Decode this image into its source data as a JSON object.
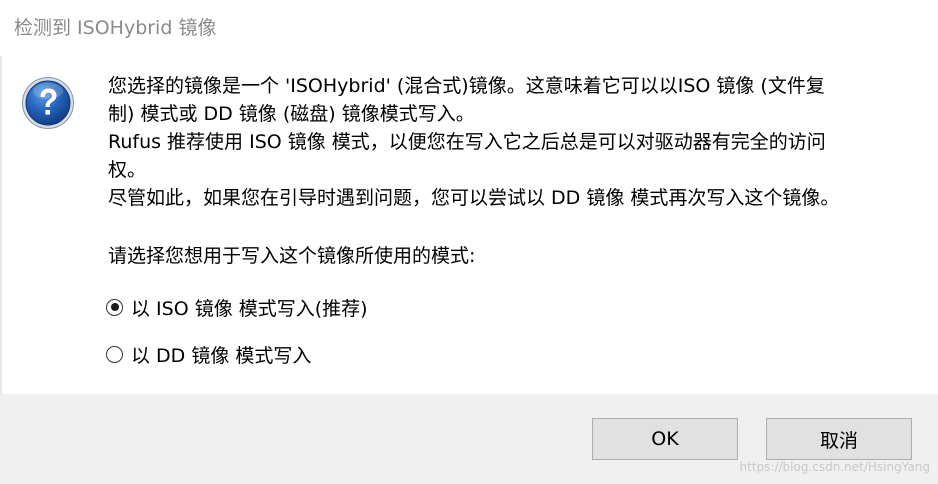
{
  "dialog": {
    "title": "检测到 ISOHybrid 镜像",
    "icon": "question-icon",
    "message_lines": [
      "您选择的镜像是一个 'ISOHybrid' (混合式)镜像。这意味着它可以以ISO 镜像 (文件复",
      "制) 模式或 DD 镜像 (磁盘) 镜像模式写入。",
      "Rufus 推荐使用 ISO 镜像 模式，以便您在写入它之后总是可以对驱动器有完全的访问",
      "权。",
      "尽管如此，如果您在引导时遇到问题，您可以尝试以 DD 镜像 模式再次写入这个镜像。"
    ],
    "prompt": "请选择您想用于写入这个镜像所使用的模式:",
    "options": [
      {
        "label": "以 ISO 镜像 模式写入(推荐)",
        "checked": true
      },
      {
        "label": "以 DD 镜像 模式写入",
        "checked": false
      }
    ],
    "buttons": {
      "ok": "OK",
      "cancel": "取消"
    }
  },
  "watermark": "https://blog.csdn.net/HsingYang",
  "colors": {
    "footer_bg": "#f0f0f0",
    "button_bg": "#e1e1e1",
    "button_border": "#adadad",
    "title_text": "#8a8a8a",
    "icon_blue": "#1e5aa8"
  }
}
